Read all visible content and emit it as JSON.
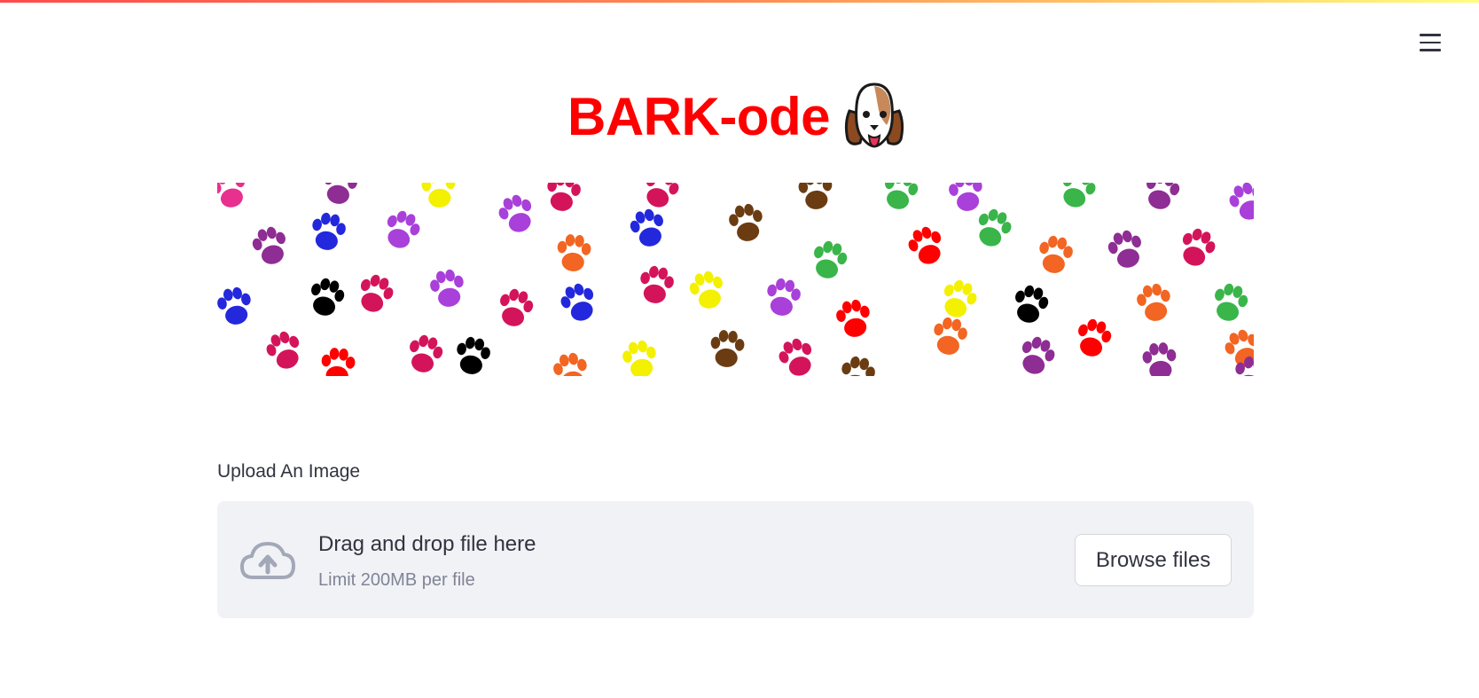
{
  "header": {
    "menu_icon": "hamburger-menu-icon"
  },
  "title": {
    "text": "BARK-ode",
    "color": "#ff0000",
    "icon": "dog-face-icon"
  },
  "banner": {
    "icon": "paw-prints-pattern",
    "paw_colors": [
      "#e8318e",
      "#8e2d93",
      "#f3f000",
      "#2328dd",
      "#000000",
      "#a940d9",
      "#d4145a",
      "#f26522",
      "#6b3c12",
      "#39b54a",
      "#ff0000"
    ]
  },
  "uploader": {
    "label": "Upload An Image",
    "drop_text": "Drag and drop file here",
    "limit_text": "Limit 200MB per file",
    "browse_label": "Browse files",
    "icon": "cloud-upload-icon"
  },
  "colors": {
    "accent": "#ff4b4b",
    "dropzone_bg": "#f0f2f6",
    "muted_text": "#808495"
  }
}
